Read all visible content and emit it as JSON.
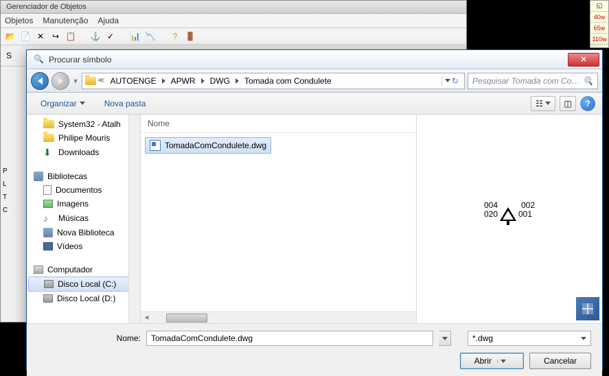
{
  "parent": {
    "title": "Gerenciador de Objetos",
    "menu": [
      "Objetos",
      "Manutenção",
      "Ajuda"
    ],
    "sidelabel": "S"
  },
  "ruler": {
    "rows": [
      "40w",
      "65w",
      "110w"
    ]
  },
  "dialog": {
    "title": "Procurar símbolo"
  },
  "breadcrumb": {
    "items": [
      "AUTOENGE",
      "APWR",
      "DWG",
      "Tomada com Condulete"
    ]
  },
  "search": {
    "placeholder": "Pesquisar Tomada com Condu..."
  },
  "toolbar": {
    "organize": "Organizar",
    "newfolder": "Nova pasta"
  },
  "sidebar": {
    "items": [
      {
        "label": "System32 - Atalh",
        "type": "folder"
      },
      {
        "label": "Philipe Mouris",
        "type": "folder"
      },
      {
        "label": "Downloads",
        "type": "download"
      }
    ],
    "libraries": {
      "header": "Bibliotecas",
      "items": [
        {
          "label": "Documentos",
          "type": "doc"
        },
        {
          "label": "Imagens",
          "type": "img"
        },
        {
          "label": "Músicas",
          "type": "music"
        },
        {
          "label": "Nova Biblioteca",
          "type": "lib"
        },
        {
          "label": "Vídeos",
          "type": "video"
        }
      ]
    },
    "computer": {
      "header": "Computador",
      "items": [
        {
          "label": "Disco Local (C:)",
          "type": "disk",
          "selected": true
        },
        {
          "label": "Disco Local (D:)",
          "type": "disk"
        }
      ]
    }
  },
  "filelist": {
    "header": "Nome",
    "files": [
      {
        "name": "TomadaComCondulete.dwg"
      }
    ]
  },
  "preview": {
    "line1a": "004",
    "line1b": "002",
    "line2a": "020",
    "line2b": "001"
  },
  "bottom": {
    "name_label": "Nome:",
    "name_value": "TomadaComCondulete.dwg",
    "filter": "*.dwg",
    "open": "Abrir",
    "cancel": "Cancelar"
  },
  "leftpanel": {
    "P": "P",
    "L": "L",
    "T": "T",
    "C": "C"
  }
}
